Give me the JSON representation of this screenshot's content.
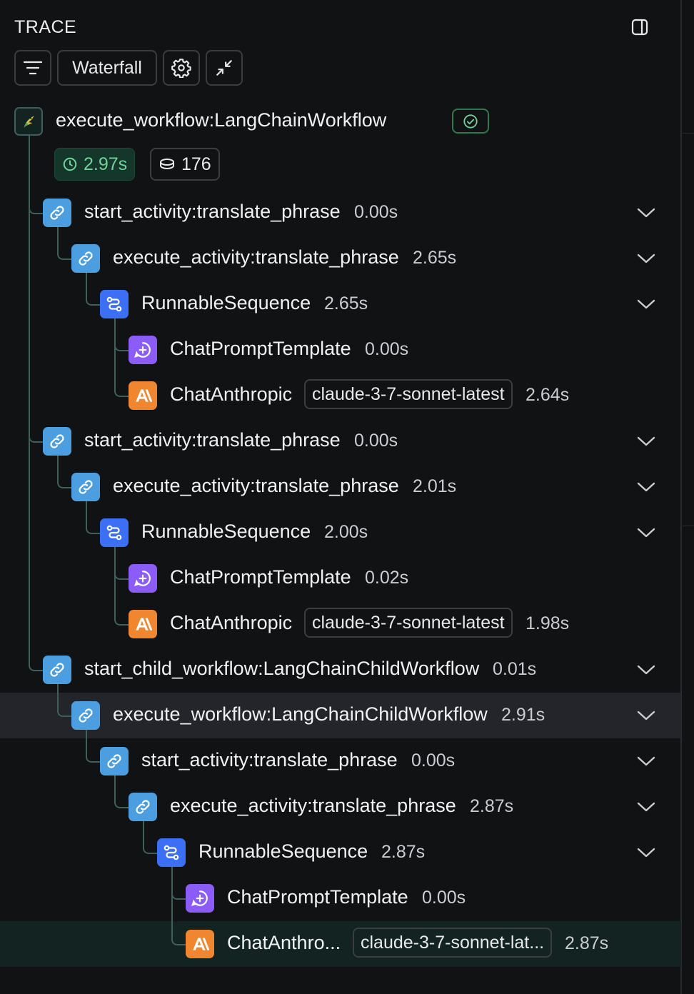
{
  "header": {
    "title": "TRACE"
  },
  "toolbar": {
    "view_label": "Waterfall"
  },
  "root": {
    "name": "execute_workflow:LangChainWorkflow",
    "latency": "2.97s",
    "tokens": "176"
  },
  "nodes": [
    {
      "name": "start_activity:translate_phrase",
      "time": "0.00s"
    },
    {
      "name": "execute_activity:translate_phrase",
      "time": "2.65s"
    },
    {
      "name": "RunnableSequence",
      "time": "2.65s"
    },
    {
      "name": "ChatPromptTemplate",
      "time": "0.00s"
    },
    {
      "name": "ChatAnthropic",
      "model": "claude-3-7-sonnet-latest",
      "time": "2.64s"
    },
    {
      "name": "start_activity:translate_phrase",
      "time": "0.00s"
    },
    {
      "name": "execute_activity:translate_phrase",
      "time": "2.01s"
    },
    {
      "name": "RunnableSequence",
      "time": "2.00s"
    },
    {
      "name": "ChatPromptTemplate",
      "time": "0.02s"
    },
    {
      "name": "ChatAnthropic",
      "model": "claude-3-7-sonnet-latest",
      "time": "1.98s"
    },
    {
      "name": "start_child_workflow:LangChainChildWorkflow",
      "time": "0.01s"
    },
    {
      "name": "execute_workflow:LangChainChildWorkflow",
      "time": "2.91s"
    },
    {
      "name": "start_activity:translate_phrase",
      "time": "0.00s"
    },
    {
      "name": "execute_activity:translate_phrase",
      "time": "2.87s"
    },
    {
      "name": "RunnableSequence",
      "time": "2.87s"
    },
    {
      "name": "ChatPromptTemplate",
      "time": "0.00s"
    },
    {
      "name": "ChatAnthro...",
      "model": "claude-3-7-sonnet-lat...",
      "time": "2.87s"
    }
  ],
  "icons": {
    "link": "link-icon",
    "sequence": "route-icon",
    "prompt": "message-plus-icon",
    "anthropic": "anthropic-logo-icon",
    "root": "parrot-icon"
  },
  "colors": {
    "link": "#4b9fe1",
    "sequence": "#3b6ff5",
    "prompt": "#8b5cf6",
    "anthropic": "#f0862f",
    "success": "#6fd39a"
  }
}
